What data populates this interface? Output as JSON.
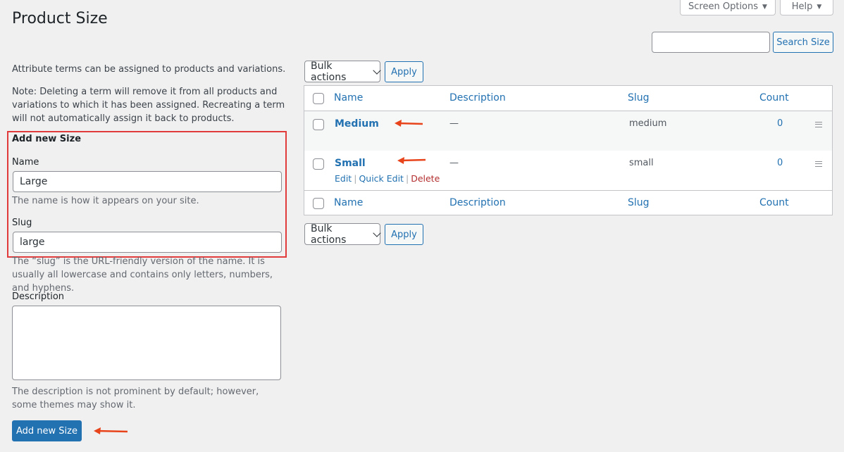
{
  "header": {
    "title": "Product Size",
    "screen_options": "Screen Options",
    "help": "Help"
  },
  "search": {
    "value": "",
    "button": "Search Size"
  },
  "intro": {
    "line1": "Attribute terms can be assigned to products and variations.",
    "note": "Note: Deleting a term will remove it from all products and variations to which it has been assigned. Recreating a term will not automatically assign it back to products."
  },
  "form": {
    "heading": "Add new Size",
    "name_label": "Name",
    "name_value": "Large",
    "name_help": "The name is how it appears on your site.",
    "slug_label": "Slug",
    "slug_value": "large",
    "slug_help": "The “slug” is the URL-friendly version of the name. It is usually all lowercase and contains only letters, numbers, and hyphens.",
    "description_label": "Description",
    "description_value": "",
    "description_help": "The description is not prominent by default; however, some themes may show it.",
    "submit": "Add new Size"
  },
  "bulk": {
    "select_label": "Bulk actions",
    "apply": "Apply"
  },
  "table": {
    "columns": [
      "Name",
      "Description",
      "Slug",
      "Count"
    ],
    "rows": [
      {
        "name": "Medium",
        "description": "—",
        "slug": "medium",
        "count": "0"
      },
      {
        "name": "Small",
        "description": "—",
        "slug": "small",
        "count": "0"
      }
    ],
    "row_actions": [
      "Edit",
      "Quick Edit",
      "Delete"
    ]
  },
  "colors": {
    "accent": "#2271b1",
    "annotation": "#e8441c",
    "highlight_box": "#e23b3b",
    "delete": "#b32d2e"
  }
}
